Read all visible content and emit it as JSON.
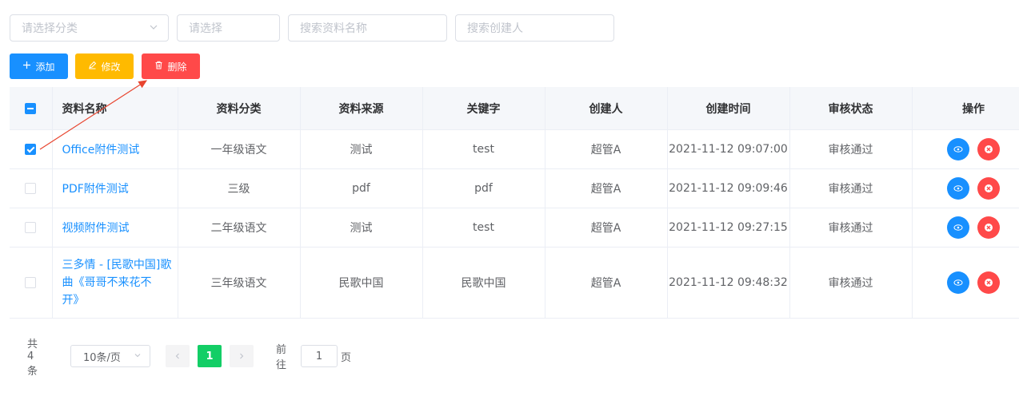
{
  "filters": {
    "category_placeholder": "请选择分类",
    "select_placeholder": "请选择",
    "name_placeholder": "搜索资料名称",
    "creator_placeholder": "搜索创建人"
  },
  "toolbar": {
    "add_label": "添加",
    "edit_label": "修改",
    "delete_label": "删除"
  },
  "colors": {
    "primary": "#1890ff",
    "warning": "#ffba00",
    "danger": "#ff4949",
    "success": "#13ce66",
    "annotation_arrow": "#e8452f"
  },
  "table": {
    "headers": [
      "资料名称",
      "资料分类",
      "资料来源",
      "关键字",
      "创建人",
      "创建时间",
      "审核状态",
      "操作"
    ],
    "rows": [
      {
        "checked": true,
        "name": "Office附件测试",
        "category": "一年级语文",
        "source": "测试",
        "keyword": "test",
        "creator": "超管A",
        "created": "2021-11-12 09:07:00",
        "status": "审核通过"
      },
      {
        "checked": false,
        "name": "PDF附件测试",
        "category": "三级",
        "source": "pdf",
        "keyword": "pdf",
        "creator": "超管A",
        "created": "2021-11-12 09:09:46",
        "status": "审核通过"
      },
      {
        "checked": false,
        "name": "视频附件测试",
        "category": "二年级语文",
        "source": "测试",
        "keyword": "test",
        "creator": "超管A",
        "created": "2021-11-12 09:27:15",
        "status": "审核通过"
      },
      {
        "checked": false,
        "name_lines": [
          "三多情 - [民歌中国]歌",
          "曲《哥哥不来花不",
          "开》"
        ],
        "category": "三年级语文",
        "source": "民歌中国",
        "keyword": "民歌中国",
        "creator": "超管A",
        "created": "2021-11-12 09:48:32",
        "status": "审核通过"
      }
    ]
  },
  "pagination": {
    "total_label": "共 4 条",
    "page_size": "10条/页",
    "current_page": "1",
    "goto_label": "前往",
    "goto_value": "1",
    "page_suffix": "页"
  },
  "icons": {
    "add": "plus-icon",
    "edit": "pencil-icon",
    "delete": "trash-icon",
    "view": "eye-icon",
    "remove": "close-circle-icon"
  }
}
